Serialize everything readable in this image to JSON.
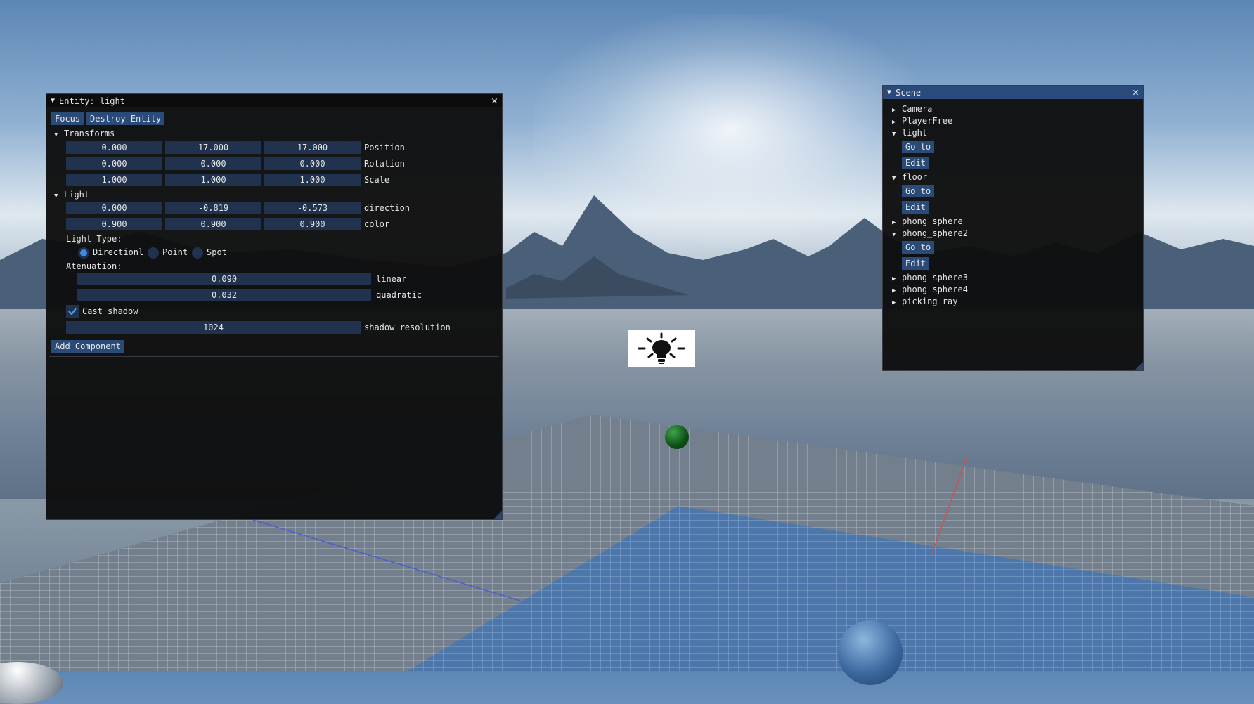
{
  "entity_window": {
    "title": "Entity: light",
    "buttons": {
      "focus": "Focus",
      "destroy": "Destroy Entity",
      "add_component": "Add Component"
    },
    "transforms": {
      "header": "Transforms",
      "position": {
        "x": "0.000",
        "y": "17.000",
        "z": "17.000",
        "label": "Position"
      },
      "rotation": {
        "x": "0.000",
        "y": "0.000",
        "z": "0.000",
        "label": "Rotation"
      },
      "scale": {
        "x": "1.000",
        "y": "1.000",
        "z": "1.000",
        "label": "Scale"
      }
    },
    "light": {
      "header": "Light",
      "direction": {
        "x": "0.000",
        "y": "-0.819",
        "z": "-0.573",
        "label": "direction"
      },
      "color": {
        "r": "0.900",
        "g": "0.900",
        "b": "0.900",
        "label": "color"
      },
      "light_type_label": "Light Type:",
      "types": [
        "Directionl",
        "Point",
        "Spot"
      ],
      "selected_type": "Directionl",
      "attenuation_label": "Atenuation:",
      "linear": {
        "value": "0.090",
        "label": "linear"
      },
      "quadratic": {
        "value": "0.032",
        "label": "quadratic"
      },
      "cast_shadow": {
        "label": "Cast shadow",
        "checked": true
      },
      "shadow_resolution": {
        "value": "1024",
        "label": "shadow resolution"
      }
    }
  },
  "scene_window": {
    "title": "Scene",
    "go_to_label": "Go to",
    "edit_label": "Edit",
    "nodes": [
      {
        "name": "Camera",
        "expanded": false
      },
      {
        "name": "PlayerFree",
        "expanded": false
      },
      {
        "name": "light",
        "expanded": true
      },
      {
        "name": "floor",
        "expanded": true
      },
      {
        "name": "phong_sphere",
        "expanded": false
      },
      {
        "name": "phong_sphere2",
        "expanded": true
      },
      {
        "name": "phong_sphere3",
        "expanded": false
      },
      {
        "name": "phong_sphere4",
        "expanded": false
      },
      {
        "name": "picking_ray",
        "expanded": false
      }
    ]
  },
  "icons": {
    "collapse": "triangle-down-icon",
    "expand": "triangle-right-icon",
    "close": "close-icon",
    "checkmark": "checkmark-icon",
    "scene_light": "lightbulb-icon"
  },
  "colors": {
    "window_bg": "#0e0e0e",
    "title_active": "#294a7a",
    "button": "#2a4a78",
    "field": "#21324f",
    "radio_selected": "#3f88e6"
  }
}
